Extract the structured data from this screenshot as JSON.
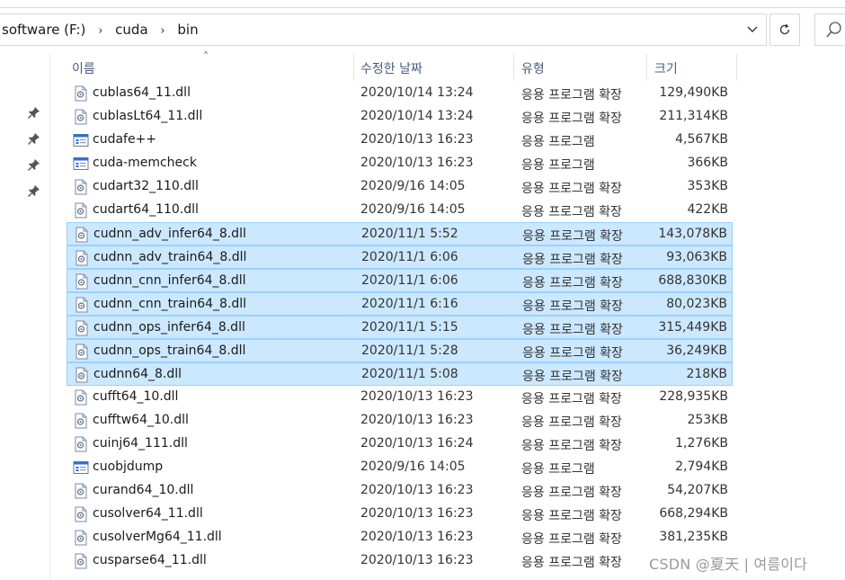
{
  "address_bar": {
    "crumbs": [
      "software (F:)",
      "cuda",
      "bin"
    ]
  },
  "columns": {
    "name": "이름",
    "date": "수정한 날짜",
    "type": "유형",
    "size": "크기"
  },
  "files": [
    {
      "name": "cublas64_11.dll",
      "date": "2020/10/14 13:24",
      "type": "응용 프로그램 확장",
      "size": "129,490KB",
      "icon": "dll-file-icon",
      "selected": false
    },
    {
      "name": "cublasLt64_11.dll",
      "date": "2020/10/14 13:24",
      "type": "응용 프로그램 확장",
      "size": "211,314KB",
      "icon": "dll-file-icon",
      "selected": false
    },
    {
      "name": "cudafe++",
      "date": "2020/10/13 16:23",
      "type": "응용 프로그램",
      "size": "4,567KB",
      "icon": "exe-file-icon",
      "selected": false
    },
    {
      "name": "cuda-memcheck",
      "date": "2020/10/13 16:23",
      "type": "응용 프로그램",
      "size": "366KB",
      "icon": "exe-file-icon",
      "selected": false
    },
    {
      "name": "cudart32_110.dll",
      "date": "2020/9/16 14:05",
      "type": "응용 프로그램 확장",
      "size": "353KB",
      "icon": "dll-file-icon",
      "selected": false
    },
    {
      "name": "cudart64_110.dll",
      "date": "2020/9/16 14:05",
      "type": "응용 프로그램 확장",
      "size": "422KB",
      "icon": "dll-file-icon",
      "selected": false
    },
    {
      "name": "cudnn_adv_infer64_8.dll",
      "date": "2020/11/1 5:52",
      "type": "응용 프로그램 확장",
      "size": "143,078KB",
      "icon": "dll-file-icon",
      "selected": true
    },
    {
      "name": "cudnn_adv_train64_8.dll",
      "date": "2020/11/1 6:06",
      "type": "응용 프로그램 확장",
      "size": "93,063KB",
      "icon": "dll-file-icon",
      "selected": true
    },
    {
      "name": "cudnn_cnn_infer64_8.dll",
      "date": "2020/11/1 6:06",
      "type": "응용 프로그램 확장",
      "size": "688,830KB",
      "icon": "dll-file-icon",
      "selected": true
    },
    {
      "name": "cudnn_cnn_train64_8.dll",
      "date": "2020/11/1 6:16",
      "type": "응용 프로그램 확장",
      "size": "80,023KB",
      "icon": "dll-file-icon",
      "selected": true
    },
    {
      "name": "cudnn_ops_infer64_8.dll",
      "date": "2020/11/1 5:15",
      "type": "응용 프로그램 확장",
      "size": "315,449KB",
      "icon": "dll-file-icon",
      "selected": true
    },
    {
      "name": "cudnn_ops_train64_8.dll",
      "date": "2020/11/1 5:28",
      "type": "응용 프로그램 확장",
      "size": "36,249KB",
      "icon": "dll-file-icon",
      "selected": true
    },
    {
      "name": "cudnn64_8.dll",
      "date": "2020/11/1 5:08",
      "type": "응용 프로그램 확장",
      "size": "218KB",
      "icon": "dll-file-icon",
      "selected": true
    },
    {
      "name": "cufft64_10.dll",
      "date": "2020/10/13 16:23",
      "type": "응용 프로그램 확장",
      "size": "228,935KB",
      "icon": "dll-file-icon",
      "selected": false
    },
    {
      "name": "cufftw64_10.dll",
      "date": "2020/10/13 16:23",
      "type": "응용 프로그램 확장",
      "size": "253KB",
      "icon": "dll-file-icon",
      "selected": false
    },
    {
      "name": "cuinj64_111.dll",
      "date": "2020/10/13 16:24",
      "type": "응용 프로그램 확장",
      "size": "1,276KB",
      "icon": "dll-file-icon",
      "selected": false
    },
    {
      "name": "cuobjdump",
      "date": "2020/9/16 14:05",
      "type": "응용 프로그램",
      "size": "2,794KB",
      "icon": "exe-file-icon",
      "selected": false
    },
    {
      "name": "curand64_10.dll",
      "date": "2020/10/13 16:23",
      "type": "응용 프로그램 확장",
      "size": "54,207KB",
      "icon": "dll-file-icon",
      "selected": false
    },
    {
      "name": "cusolver64_11.dll",
      "date": "2020/10/13 16:23",
      "type": "응용 프로그램 확장",
      "size": "668,294KB",
      "icon": "dll-file-icon",
      "selected": false
    },
    {
      "name": "cusolverMg64_11.dll",
      "date": "2020/10/13 16:23",
      "type": "응용 프로그램 확장",
      "size": "381,235KB",
      "icon": "dll-file-icon",
      "selected": false
    },
    {
      "name": "cusparse64_11.dll",
      "date": "2020/10/13 16:23",
      "type": "응용 프로그램 확장",
      "size": "",
      "icon": "dll-file-icon",
      "selected": false
    }
  ],
  "watermark": "CSDN @夏天 | 여름이다",
  "colors": {
    "selection_bg": "#cce8ff",
    "selection_border": "#99d1ff",
    "header_text": "#4a5a80"
  }
}
